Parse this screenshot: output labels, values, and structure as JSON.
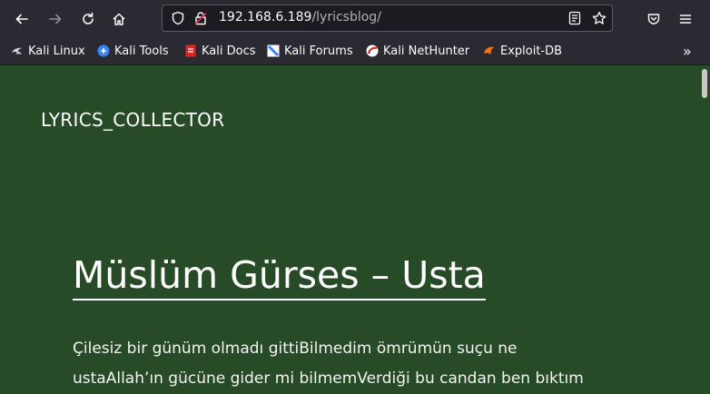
{
  "browser": {
    "url_host": "192.168.6.189",
    "url_path": "/lyricsblog/",
    "icons": [
      "back-arrow",
      "forward-arrow",
      "reload",
      "home",
      "shield",
      "lock-warning",
      "reader-mode",
      "star",
      "pocket",
      "menu"
    ]
  },
  "bookmarks": [
    {
      "label": "Kali Linux",
      "icon": "kali-dragon",
      "color": "#9ab"
    },
    {
      "label": "Kali Tools",
      "icon": "kali-tools",
      "color": "#3b82f6"
    },
    {
      "label": "Kali Docs",
      "icon": "kali-docs",
      "color": "#dc2626"
    },
    {
      "label": "Kali Forums",
      "icon": "kali-forums",
      "color": "#3b82f6"
    },
    {
      "label": "Kali NetHunter",
      "icon": "nethunter",
      "color": "#dc2626"
    },
    {
      "label": "Exploit-DB",
      "icon": "exploit-db",
      "color": "#f97316"
    }
  ],
  "page": {
    "site_title": "LYRICS_COLLECTOR",
    "post_title": "Müslüm Gürses – Usta",
    "line1": "Çilesiz bir günüm olmadı gittiBilmedim ömrümün suçu ne",
    "line2": "ustaAllah’ın gücüne gider mi bilmemVerdiği bu candan ben bıktım"
  },
  "colors": {
    "page_bg": "#284b27",
    "chrome_bg": "#2b2a33",
    "url_bg": "#1c1b22"
  }
}
